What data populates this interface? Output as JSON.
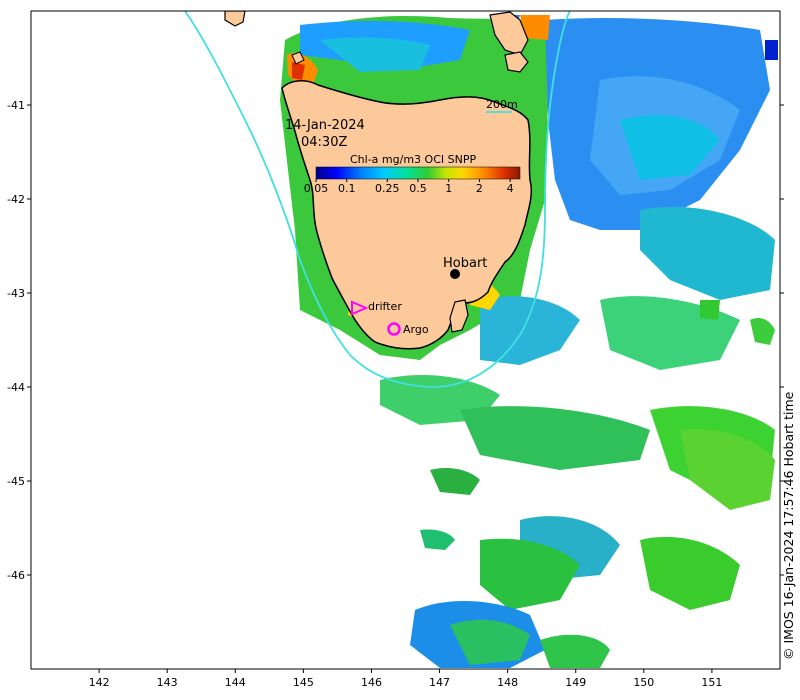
{
  "map": {
    "date": "14-Jan-2024",
    "time": "04:30Z",
    "isobath_label": "200m",
    "colorbar": {
      "title": "Chl-a mg/m3 OCI SNPP",
      "ticks": [
        "0.05",
        "0.1",
        "0.25",
        "0.5",
        "1",
        "2",
        "4"
      ],
      "tick_values": [
        0.05,
        0.1,
        0.25,
        0.5,
        1,
        2,
        4
      ],
      "range": [
        0.05,
        5
      ],
      "scale": "log",
      "colors": [
        "#00008b",
        "#0000ff",
        "#0080ff",
        "#00c8ff",
        "#00e0a0",
        "#32cd32",
        "#c8e600",
        "#ffd700",
        "#ff8c00",
        "#e03000",
        "#8b1a00"
      ]
    },
    "x_axis": {
      "ticks": [
        "142",
        "143",
        "144",
        "145",
        "146",
        "147",
        "148",
        "149",
        "150",
        "151"
      ],
      "values": [
        142,
        143,
        144,
        145,
        146,
        147,
        148,
        149,
        150,
        151
      ],
      "range": [
        141,
        152
      ]
    },
    "y_axis": {
      "ticks": [
        "-41",
        "-42",
        "-43",
        "-44",
        "-45",
        "-46"
      ],
      "values": [
        -41,
        -42,
        -43,
        -44,
        -45,
        -46
      ],
      "range": [
        -47,
        -40
      ]
    },
    "markers": {
      "city": "Hobart",
      "drifter": "drifter",
      "argo": "Argo"
    },
    "credit": "© IMOS 16-Jan-2024 17:57:46 Hobart time",
    "colors": {
      "land": "#fcc99b",
      "coast": "#000000",
      "isobath": "#40e0e0",
      "drifter": "#ff00ff",
      "argo": "#ff00ff"
    }
  }
}
